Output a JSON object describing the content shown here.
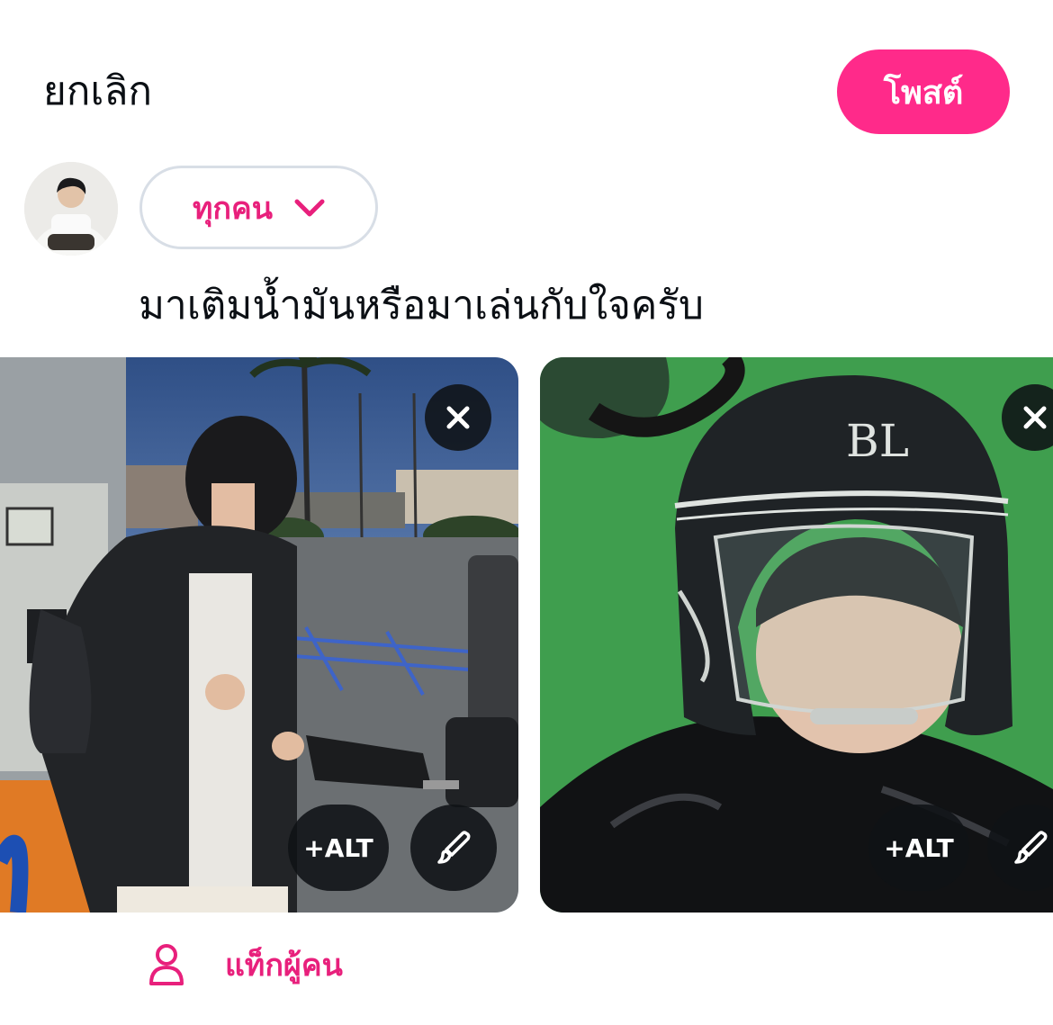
{
  "header": {
    "cancel_label": "ยกเลิก",
    "post_label": "โพสต์"
  },
  "composer": {
    "audience_label": "ทุกคน",
    "text": "มาเติมน้ำมันหรือมาเล่นกับใจครับ"
  },
  "media": [
    {
      "alt_label": "+ALT"
    },
    {
      "alt_label": "+ALT"
    }
  ],
  "footer": {
    "tag_people_label": "แท็กผู้คน"
  },
  "colors": {
    "accent": "#ff2a8a",
    "accent_text": "#e8207c",
    "text": "#0b0f14"
  },
  "icons": [
    "chevron-down-icon",
    "close-icon",
    "brush-icon",
    "person-icon"
  ]
}
